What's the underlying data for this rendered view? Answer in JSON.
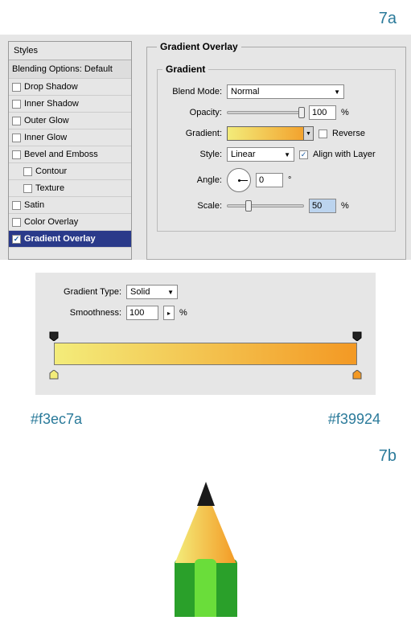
{
  "labels": {
    "fig_a": "7a",
    "fig_b": "7b"
  },
  "styles_panel": {
    "header": "Styles",
    "blending": "Blending Options: Default",
    "items": [
      {
        "label": "Drop Shadow",
        "checked": false,
        "indent": false
      },
      {
        "label": "Inner Shadow",
        "checked": false,
        "indent": false
      },
      {
        "label": "Outer Glow",
        "checked": false,
        "indent": false
      },
      {
        "label": "Inner Glow",
        "checked": false,
        "indent": false
      },
      {
        "label": "Bevel and Emboss",
        "checked": false,
        "indent": false
      },
      {
        "label": "Contour",
        "checked": false,
        "indent": true
      },
      {
        "label": "Texture",
        "checked": false,
        "indent": true
      },
      {
        "label": "Satin",
        "checked": false,
        "indent": false
      },
      {
        "label": "Color Overlay",
        "checked": false,
        "indent": false
      },
      {
        "label": "Gradient Overlay",
        "checked": true,
        "indent": false,
        "selected": true
      }
    ]
  },
  "gradient_overlay": {
    "title": "Gradient Overlay",
    "subtitle": "Gradient",
    "blend_mode": {
      "label": "Blend Mode:",
      "value": "Normal"
    },
    "opacity": {
      "label": "Opacity:",
      "value": "100",
      "pct": "%"
    },
    "gradient": {
      "label": "Gradient:",
      "reverse_label": "Reverse",
      "reverse": false
    },
    "style": {
      "label": "Style:",
      "value": "Linear",
      "align_label": "Align with Layer",
      "align": true
    },
    "angle": {
      "label": "Angle:",
      "value": "0",
      "deg": "°"
    },
    "scale": {
      "label": "Scale:",
      "value": "50",
      "pct": "%"
    }
  },
  "gradient_editor": {
    "type_label": "Gradient Type:",
    "type_value": "Solid",
    "smooth_label": "Smoothness:",
    "smooth_value": "100",
    "pct": "%"
  },
  "colors": {
    "left": "#f3ec7a",
    "right": "#f39924"
  },
  "chart_data": {
    "type": "table",
    "title": "Gradient Overlay settings",
    "rows": [
      [
        "Blend Mode",
        "Normal"
      ],
      [
        "Opacity",
        "100%"
      ],
      [
        "Reverse",
        "false"
      ],
      [
        "Style",
        "Linear"
      ],
      [
        "Align with Layer",
        "true"
      ],
      [
        "Angle",
        "0°"
      ],
      [
        "Scale",
        "50%"
      ],
      [
        "Gradient Type",
        "Solid"
      ],
      [
        "Smoothness",
        "100%"
      ],
      [
        "Left stop color",
        "#f3ec7a"
      ],
      [
        "Right stop color",
        "#f39924"
      ]
    ]
  }
}
